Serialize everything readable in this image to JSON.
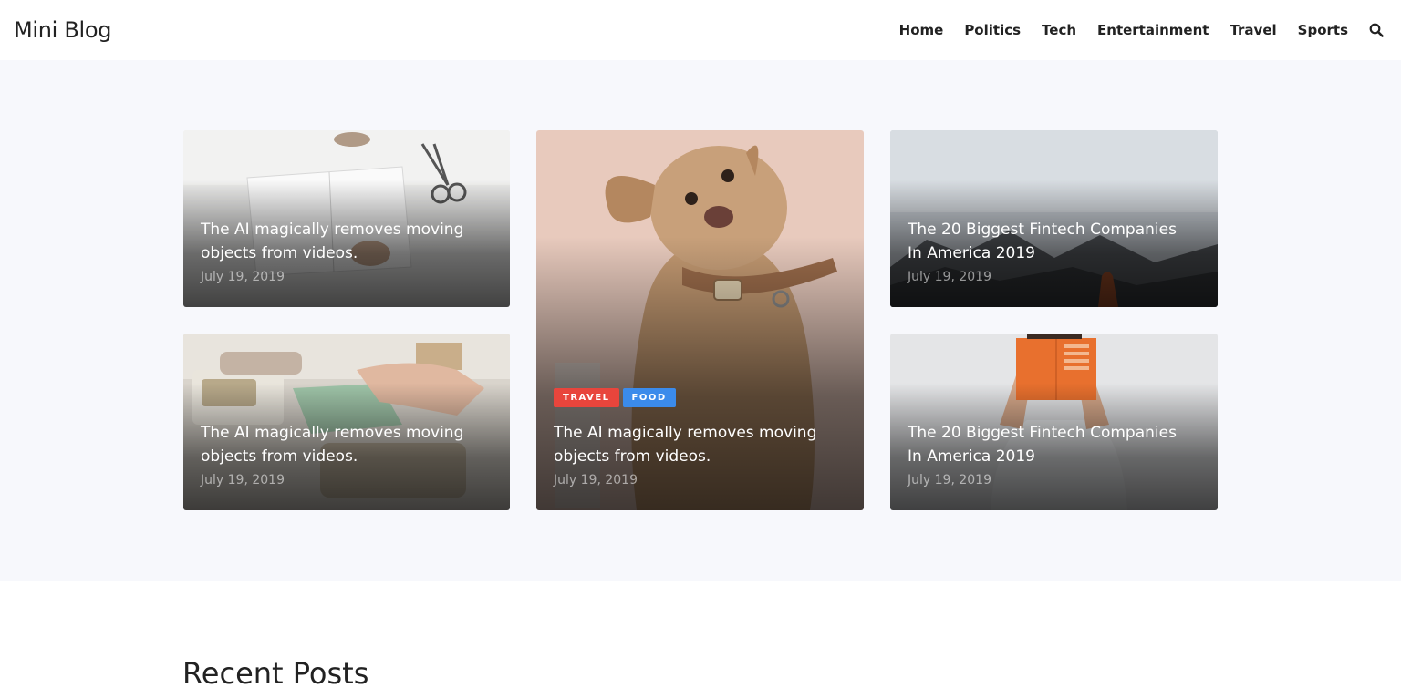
{
  "header": {
    "logo": "Mini Blog",
    "nav": [
      "Home",
      "Politics",
      "Tech",
      "Entertainment",
      "Travel",
      "Sports"
    ],
    "search_icon": "search-icon"
  },
  "featured": [
    {
      "title": "The AI magically removes moving objects from videos.",
      "date": "July 19, 2019",
      "image": "notebook-scissors"
    },
    {
      "title": "The AI magically removes moving objects from videos.",
      "date": "July 19, 2019",
      "image": "hands-soap-box"
    },
    {
      "title": "The AI magically removes moving objects from videos.",
      "date": "July 19, 2019",
      "image": "puppy",
      "tags": [
        {
          "label": "TRAVEL",
          "color": "#e8453c"
        },
        {
          "label": "FOOD",
          "color": "#3b8beb"
        }
      ]
    },
    {
      "title": "The 20 Biggest Fintech Companies In America 2019",
      "date": "July 19, 2019",
      "image": "foggy-mountains"
    },
    {
      "title": "The 20 Biggest Fintech Companies In America 2019",
      "date": "July 19, 2019",
      "image": "man-reading-book"
    }
  ],
  "recent": {
    "title": "Recent Posts"
  },
  "colors": {
    "hero_bg": "#f7f8fc",
    "travel_tag": "#e8453c",
    "food_tag": "#3b8beb"
  }
}
